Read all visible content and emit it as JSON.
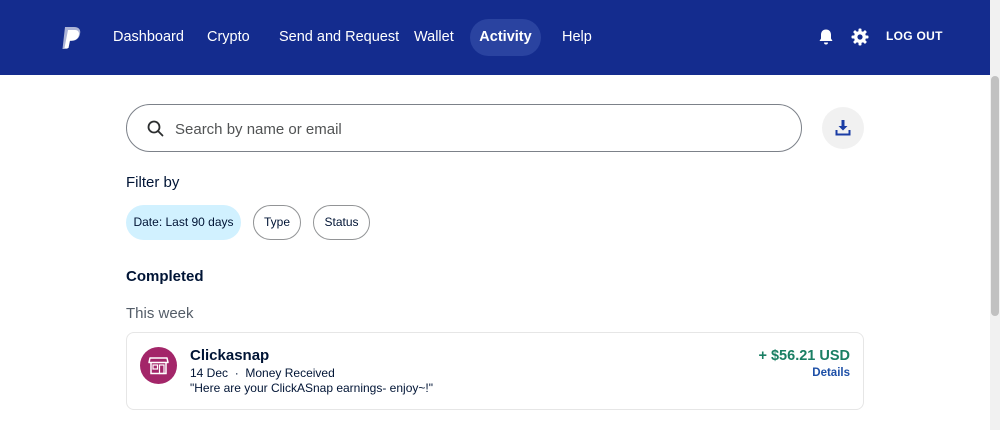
{
  "header": {
    "nav": [
      {
        "label": "Dashboard",
        "active": false
      },
      {
        "label": "Crypto",
        "active": false
      },
      {
        "label": "Send and Request",
        "active": false
      },
      {
        "label": "Wallet",
        "active": false
      },
      {
        "label": "Activity",
        "active": true
      },
      {
        "label": "Help",
        "active": false
      }
    ],
    "logout_label": "LOG OUT",
    "icons": {
      "logo": "paypal-logo-icon",
      "notifications": "bell-icon",
      "settings": "gear-icon"
    },
    "brand_color": "#142c8e"
  },
  "search": {
    "placeholder": "Search by name or email",
    "value": "",
    "download_icon": "download-icon"
  },
  "filters": {
    "label": "Filter by",
    "chips": [
      {
        "label": "Date: Last 90 days",
        "selected": true
      },
      {
        "label": "Type",
        "selected": false
      },
      {
        "label": "Status",
        "selected": false
      }
    ]
  },
  "activity": {
    "section_title": "Completed",
    "groups": [
      {
        "label": "This week",
        "transactions": [
          {
            "name": "Clickasnap",
            "date": "14 Dec",
            "separator": "·",
            "type": "Money Received",
            "note": "\"Here are your ClickASnap earnings- enjoy~!\"",
            "amount": "+ $56.21 USD",
            "details_label": "Details",
            "avatar_icon": "storefront-icon",
            "avatar_color": "#a32669",
            "amount_color": "#1a7f64"
          }
        ]
      }
    ]
  }
}
